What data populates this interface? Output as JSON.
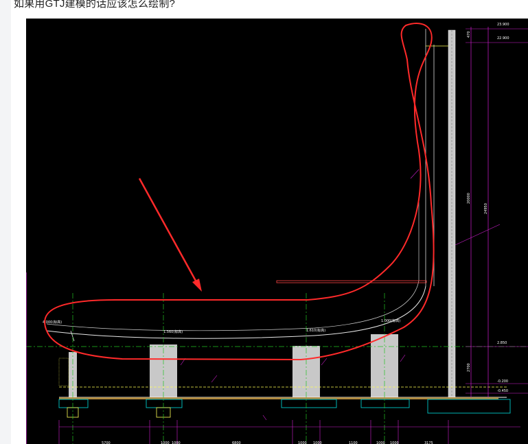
{
  "post": {
    "question": "如果用GTJ建模的话应该怎么绘制?"
  },
  "drawing": {
    "colors": {
      "background": "#000000",
      "annotation_red": "#ff2a2a",
      "dimension_magenta": "#d21fd2",
      "axis_green": "#22c422",
      "concrete_gray": "#c8c8c8",
      "foundation_cyan": "#00c8c8",
      "slab_line": "#e8e8e8"
    },
    "elevations": {
      "top_1": "23.900",
      "top_2": "22.900",
      "mid": "2.850",
      "bottom_1": "-0.200",
      "bottom_2": "-0.450"
    },
    "dims_vertical": {
      "d1": "470",
      "d2": "20000",
      "d3": "24950",
      "d4": "2700"
    },
    "dims_bottom": [
      "5700",
      "1000",
      "1000",
      "6800",
      "1000",
      "1000",
      "1100",
      "1000",
      "1000",
      "3175"
    ],
    "level_tags": [
      "4.000(标高)",
      "1.560(标高)",
      "1.610(标高)",
      "1.000(标高)"
    ]
  }
}
